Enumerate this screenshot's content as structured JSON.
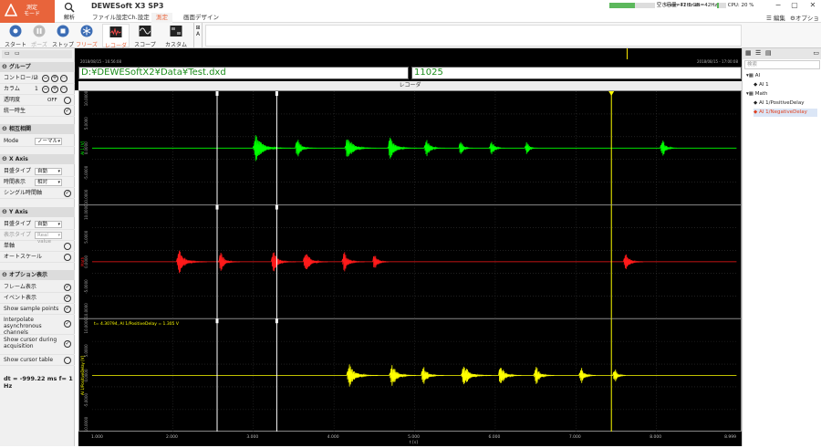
{
  "app": {
    "title": "DEWESoft X3 SP3",
    "logo_sub": "測定\nモード",
    "tools": [
      {
        "label": "解析"
      }
    ],
    "menu_tabs": [
      {
        "label": "ファイル設定"
      },
      {
        "label": "Ch.設定"
      },
      {
        "label": "測定"
      },
      {
        "label": "画面デザイン"
      }
    ],
    "status": {
      "disk_label": "空き容量: 71.2 GB",
      "disk_fill": 0.55,
      "rate_label": "ex=42Hz ds=42Hz",
      "cpu_label": "CPU: 20 %",
      "cpu_fill": 0.2,
      "edit_label": "編集",
      "option_label": "オプション"
    }
  },
  "toolbar": {
    "buttons": [
      {
        "label": "スタート"
      },
      {
        "label": "ポーズ"
      },
      {
        "label": "ストップ"
      },
      {
        "label": "フリーズ"
      },
      {
        "label": "レコーダ"
      },
      {
        "label": "スコープ"
      },
      {
        "label": "カスタム"
      }
    ],
    "addlabel": "A"
  },
  "left_panel": {
    "group_header": "グループ",
    "controller_label": "コントロール",
    "controller_value": "3",
    "column_label": "カラム",
    "column_value": "1",
    "transparency_label": "透明度",
    "transparency_value": "OFF",
    "unify_label": "統一時生",
    "interaction_header": "相互相関",
    "mode_label": "Mode",
    "mode_value": "ノーマル",
    "xaxis_header": "X Axis",
    "x_scale_type_label": "目盛タイプ",
    "x_scale_type_value": "自動",
    "time_display_label": "時間表示",
    "time_display_value": "相対",
    "single_time_label": "シングル時間軸",
    "yaxis_header": "Y Axis",
    "y_scale_type_label": "目盛タイプ",
    "y_scale_type_value": "自動",
    "display_type_label": "表示タイプ",
    "display_type_value": "Real value",
    "single_label": "単軸",
    "autoscale_label": "オートスケール",
    "options_header": "オプション表示",
    "frame_label": "フレーム表示",
    "event_label": "イベント表示",
    "sample_points_label": "Show sample points",
    "interpolate_label": "Interpolate asynchronous channels",
    "cursor_acq_label": "Show cursor during acquisition",
    "cursor_table_label": "Show cursor table",
    "dt_text": "dt = -999.22 ms  f= 1 Hz"
  },
  "overview": {
    "left_time": "2018/08/15 - 16:56:08",
    "right_time": "2018/08/15 - 17:00:08"
  },
  "file_path": "D:¥DEWESoftX2¥Data¥Test.dxd",
  "sample_count": "11025",
  "recorder_title": "レコーダ",
  "plots": [
    {
      "ylabel": "AI 1 [V]",
      "yticks": [
        "10.0000",
        "5.0000",
        "0.0000",
        "-5.0000",
        "-10.0000"
      ]
    },
    {
      "ylabel": "Math",
      "yticks": [
        "10.0000",
        "5.0000",
        "0.0000",
        "-5.0000",
        "-10.0000"
      ]
    },
    {
      "ylabel": "AI 1/PositiveDelay [V]",
      "cursor_text": "t= 4.30794, AI 1/PositiveDelay = 1.305 V",
      "yticks": [
        "10.0000",
        "5.0000",
        "0.0000",
        "-5.0000",
        "-10.0000"
      ]
    }
  ],
  "xaxis": {
    "ticks": [
      "1.000",
      "2.000",
      "3.000",
      "4.000",
      "5.000",
      "6.000",
      "7.000",
      "8.000",
      "8.999"
    ],
    "label": "t [s]"
  },
  "colors": {
    "ch1": "#00ff00",
    "ch2": "#ff1a1a",
    "ch3": "#ffff00",
    "accent": "#e8643b"
  },
  "right_panel": {
    "search_placeholder": "検索",
    "tree": [
      {
        "label": "AI",
        "level": 0
      },
      {
        "label": "AI 1",
        "level": 1
      },
      {
        "label": "Math",
        "level": 0
      },
      {
        "label": "AI 1/PositiveDelay",
        "level": 1
      },
      {
        "label": "AI 1/NegativeDelay",
        "level": 1
      }
    ]
  }
}
